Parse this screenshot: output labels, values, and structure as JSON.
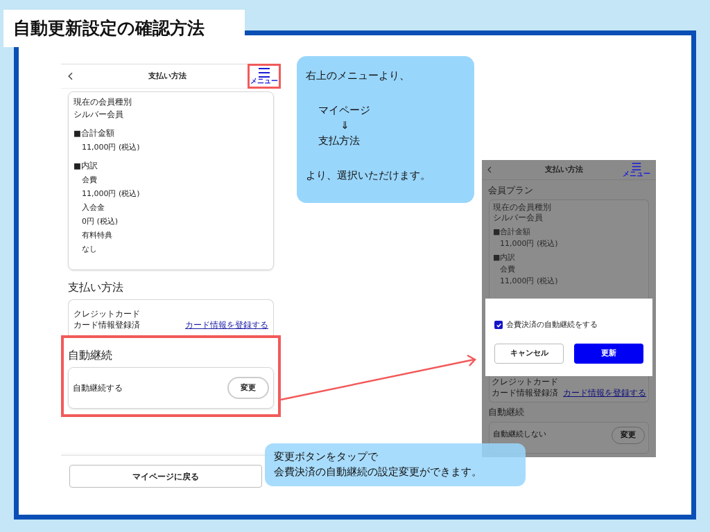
{
  "title": "自動更新設定の確認方法",
  "left_screen": {
    "header": {
      "title": "支払い方法",
      "menu_label": "メニュー",
      "menu_highlighted": true
    },
    "plan_card": [
      {
        "kind": "label",
        "text": "現在の会員種別"
      },
      {
        "kind": "label",
        "text": "シルバー会員"
      },
      {
        "kind": "section",
        "text": "■合計金額"
      },
      {
        "kind": "sub",
        "text": "11,000円 (税込)"
      },
      {
        "kind": "section",
        "text": "■内訳"
      },
      {
        "kind": "sub",
        "text": "会費"
      },
      {
        "kind": "sub",
        "text": "11,000円 (税込)"
      },
      {
        "kind": "sub",
        "text": "入会金"
      },
      {
        "kind": "sub",
        "text": "0円 (税込)"
      },
      {
        "kind": "sub",
        "text": "有料特典"
      },
      {
        "kind": "sub",
        "text": "なし"
      }
    ],
    "payment": {
      "heading": "支払い方法",
      "method": "クレジットカード",
      "status": "カード情報登録済",
      "link": "カード情報を登録する"
    },
    "auto_renew": {
      "heading": "自動継続",
      "highlighted": true,
      "status": "自動継続する",
      "button": "変更"
    },
    "back_button": "マイページに戻る"
  },
  "right_screen": {
    "dimmed": true,
    "header": {
      "title": "支払い方法",
      "menu_label": "メニュー"
    },
    "plan_heading": "会員プラン",
    "plan_card": [
      {
        "kind": "label",
        "text": "現在の会員種別"
      },
      {
        "kind": "label",
        "text": "シルバー会員"
      },
      {
        "kind": "section",
        "text": "■合計金額"
      },
      {
        "kind": "sub",
        "text": "11,000円 (税込)"
      },
      {
        "kind": "section",
        "text": "■内訳"
      },
      {
        "kind": "sub",
        "text": "会費"
      },
      {
        "kind": "sub",
        "text": "11,000円 (税込)"
      }
    ],
    "dialog": {
      "checkbox_label": "会費決済の自動継続をする",
      "checked": true,
      "cancel": "キャンセル",
      "confirm": "更新"
    },
    "payment": {
      "method": "クレジットカード",
      "status": "カード情報登録済",
      "link": "カード情報を登録する"
    },
    "auto_renew": {
      "heading": "自動継続",
      "status": "自動継続しない",
      "button": "変更"
    }
  },
  "callouts": [
    {
      "lines": [
        {
          "kind": "plain",
          "text": "右上のメニューより、"
        },
        {
          "kind": "indent",
          "text": "マイページ"
        },
        {
          "kind": "arrow",
          "text": "⇓"
        },
        {
          "kind": "indent",
          "text": "支払方法"
        },
        {
          "kind": "plain",
          "text": "より、選択いただけます。"
        }
      ]
    },
    {
      "lines": [
        {
          "kind": "plain",
          "text": "変更ボタンをタップで"
        },
        {
          "kind": "plain",
          "text": "会費決済の自動継続の設定変更ができます。"
        }
      ]
    }
  ]
}
